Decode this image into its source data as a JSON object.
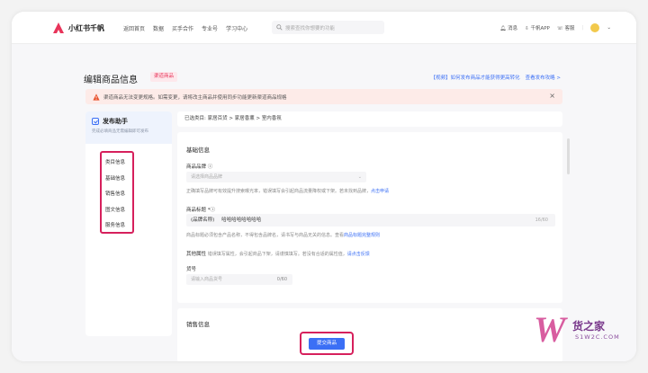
{
  "topbar": {
    "logo_text": "小红书千帆",
    "nav": [
      "返回首页",
      "数据",
      "买手合作",
      "专业号",
      "学习中心"
    ],
    "search_placeholder": "搜索查找你想要的功能",
    "right": [
      "消息",
      "千帆APP",
      "客服"
    ]
  },
  "page": {
    "title": "编辑商品信息",
    "tag": "渠道商品",
    "links": [
      "【视频】如何发布商品才能获得更高转化",
      "查看发布攻略 >"
    ]
  },
  "alert": {
    "text": "渠道商品无法变更规格。如需变更，请将改主商品并使用同步功能更新渠道商品规格",
    "close": "×"
  },
  "sidebar": {
    "helper_title": "发布助手",
    "helper_sub": "完成必填商品无需编辑即可发布",
    "items": [
      "类目信息",
      "基础信息",
      "销售信息",
      "图文信息",
      "服务信息"
    ]
  },
  "breadcrumb": "已选类目: 家居百货 > 家居香薰 > 室内香氛",
  "basic": {
    "section_title": "基础信息",
    "brand_label": "商品品牌 ⓘ",
    "brand_placeholder": "请选择商品品牌",
    "brand_hint": "正确填写品牌可有效提升搜索曝光率，错误填写会引起商品流量降权或下架。若未找到品牌，",
    "brand_hint_link": "点击申请",
    "title_label": "商品标题 *ⓘ",
    "title_prefix": "(品牌名称)",
    "title_value": "哈哈哈哈哈哈哈哈",
    "title_count": "16/60",
    "title_hint": "商品标题必须包含产品名称，不得包含品牌名，请书写与商品无关的信息。查看",
    "title_hint_link": "商品标题完整规则",
    "attr_label": "其他属性",
    "attr_hint": "错误填写属性，会引起商品下架，请谨慎填写。若没有合适的属性值，",
    "attr_hint_link": "请点击反馈",
    "model_label": "货号",
    "model_placeholder": "请输入商品货号",
    "model_count": "0/60"
  },
  "sales": {
    "section_title": "销售信息"
  },
  "submit_label": "提交商品",
  "watermark": {
    "letter": "W",
    "text": "货之家",
    "sub": "S1W2C.COM"
  },
  "colors": {
    "accent": "#3b6ff5",
    "highlight": "#d6205c",
    "brand_red": "#e8345a"
  }
}
